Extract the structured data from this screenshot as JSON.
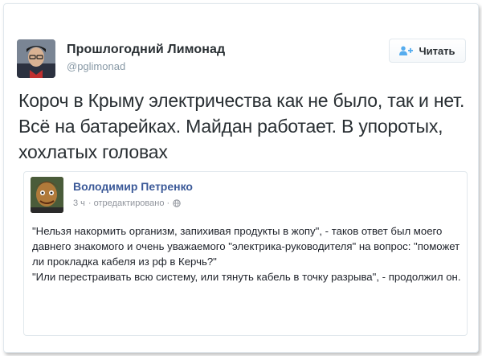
{
  "tweet": {
    "author_name": "Прошлогодний Лимонад",
    "author_handle": "@pglimonad",
    "follow_label": "Читать",
    "text": "Короч в Крыму электричества как не было, так и нет. Всё на батарейках. Майдан работает. В упоротых, хохлатых головах"
  },
  "quoted_post": {
    "author_name": "Володимир Петренко",
    "time": "3 ч",
    "edited": "· отредактировано ·",
    "paragraphs": [
      "\"Нельзя накормить организм, запихивая продукты в жопу\", - таков ответ был моего давнего знакомого и очень уважаемого \"электрика-руководителя\" на вопрос: \"поможет ли прокладка кабеля из рф в Керчь?\"",
      "\"Или перестраивать всю систему, или тянуть кабель в точку разрыва\", - продолжил он."
    ]
  },
  "colors": {
    "text": "#292f33",
    "handle": "#8899a6",
    "fb_link": "#3b5998",
    "border": "#e1e8ed",
    "follow_icon": "#55acee"
  },
  "icons": {
    "follow": "add-user-icon",
    "privacy": "globe-icon"
  }
}
